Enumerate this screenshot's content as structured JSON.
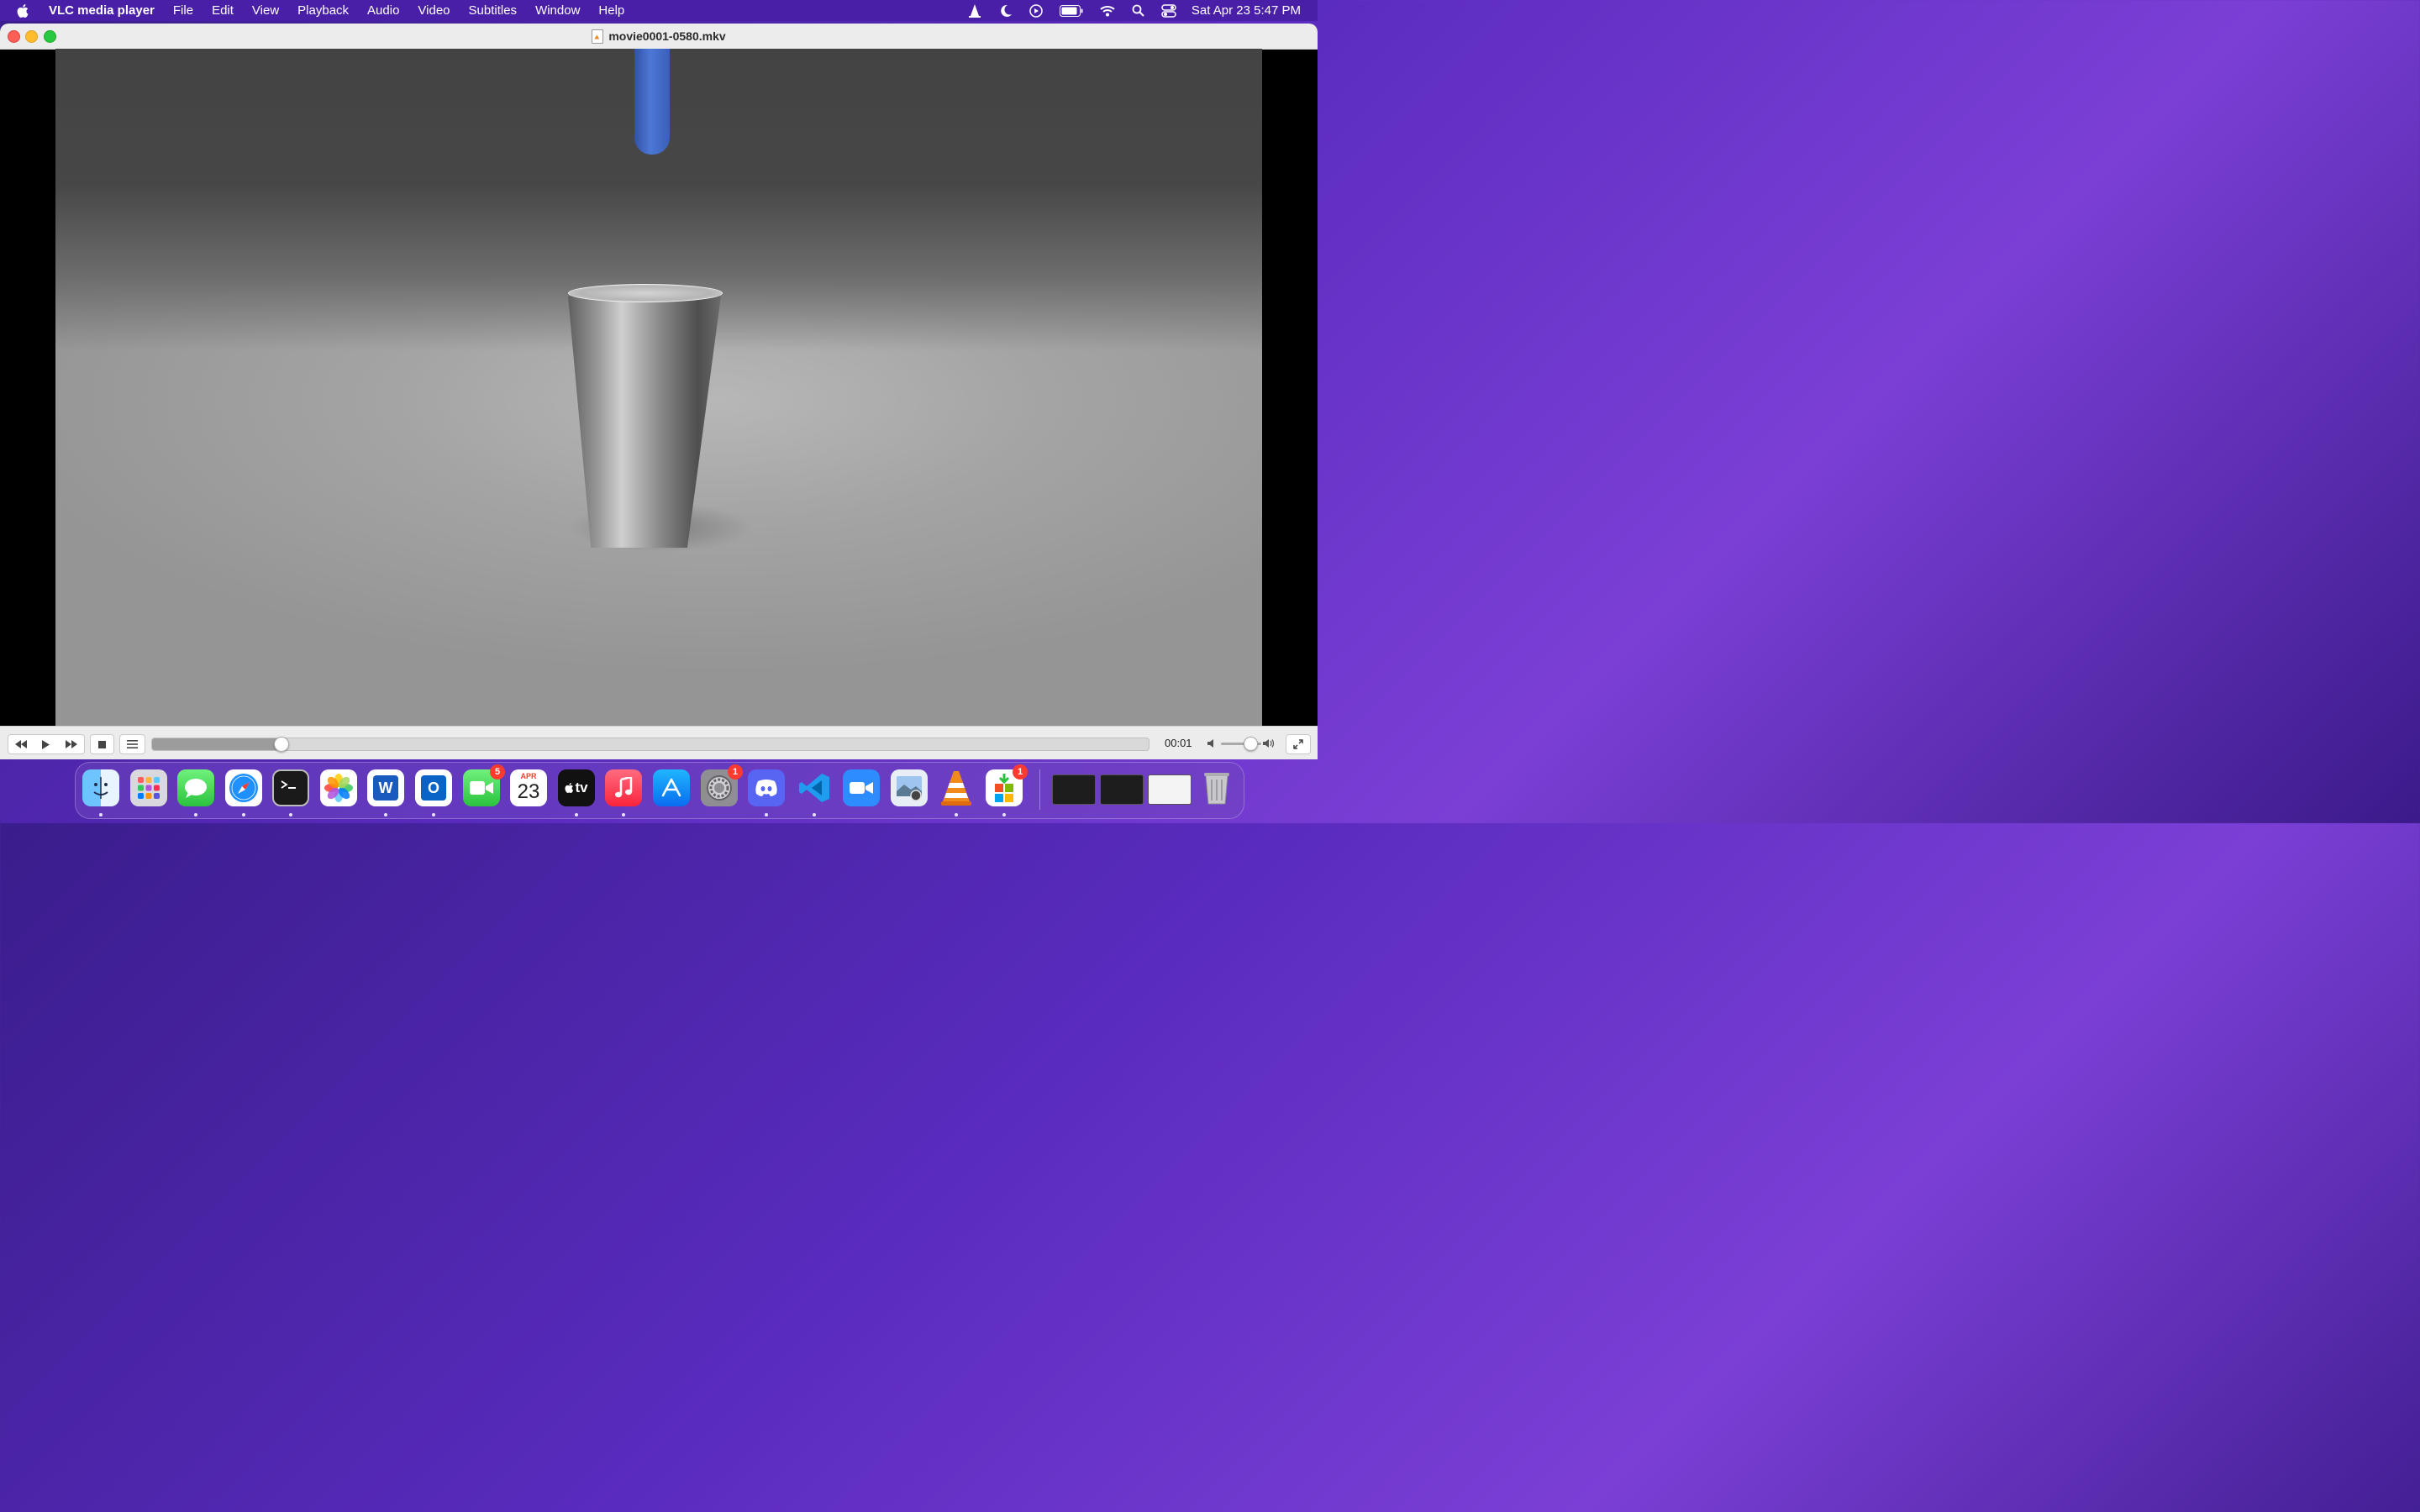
{
  "menubar": {
    "app_name": "VLC media player",
    "items": [
      "File",
      "Edit",
      "View",
      "Playback",
      "Audio",
      "Video",
      "Subtitles",
      "Window",
      "Help"
    ],
    "clock": "Sat Apr 23  5:47 PM"
  },
  "window": {
    "title": "movie0001-0580.mkv"
  },
  "player": {
    "elapsed": "00:01",
    "progress_fraction": 0.13,
    "volume_fraction": 0.7
  },
  "dock": {
    "calendar_month": "APR",
    "calendar_day": "23",
    "facetime_badge": "5",
    "settings_badge": "1",
    "installer_badge": "1",
    "appletv_label": "tv",
    "word_letter": "W",
    "outlook_letter": "O"
  },
  "colors": {
    "menubar_bg": "#4a1fa8",
    "dock_bg": "#6e46be",
    "badge_red": "#ff3b30",
    "vlc_orange": "#f08a1c"
  }
}
